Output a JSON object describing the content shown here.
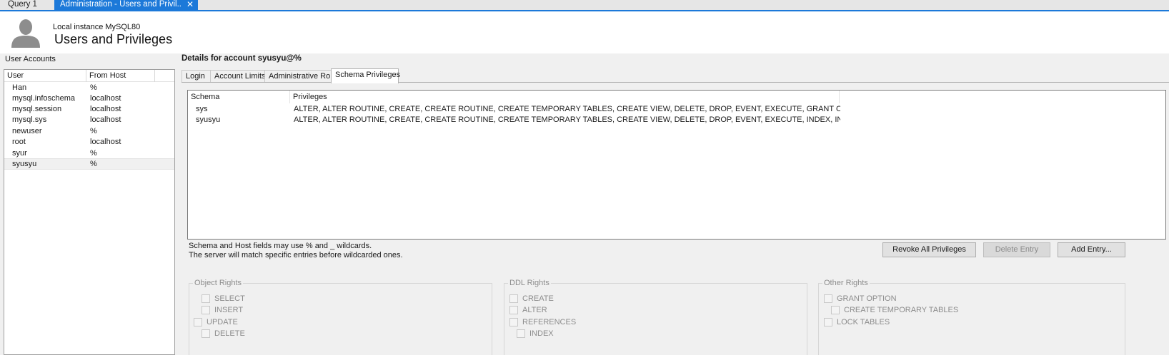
{
  "tabs": [
    {
      "label": "Query 1"
    },
    {
      "label": "Administration - Users and Privil..."
    }
  ],
  "header": {
    "subtitle": "Local instance MySQL80",
    "title": "Users and Privileges"
  },
  "accounts": {
    "label": "User Accounts",
    "columns": [
      "User",
      "From Host"
    ],
    "rows": [
      {
        "user": "Han",
        "host": "%"
      },
      {
        "user": "mysql.infoschema",
        "host": "localhost"
      },
      {
        "user": "mysql.session",
        "host": "localhost"
      },
      {
        "user": "mysql.sys",
        "host": "localhost"
      },
      {
        "user": "newuser",
        "host": "%"
      },
      {
        "user": "root",
        "host": "localhost"
      },
      {
        "user": "syur",
        "host": "%"
      },
      {
        "user": "syusyu",
        "host": "%"
      }
    ],
    "selected_user": "syusyu"
  },
  "details": {
    "label": "Details for account syusyu@%",
    "subtabs": [
      {
        "label": "Login"
      },
      {
        "label": "Account Limits"
      },
      {
        "label": "Administrative Roles"
      },
      {
        "label": "Schema Privileges"
      }
    ],
    "active_subtab": "Schema Privileges",
    "schema_table": {
      "columns": [
        "Schema",
        "Privileges"
      ],
      "rows": [
        {
          "schema": "sys",
          "privileges": "ALTER, ALTER ROUTINE, CREATE, CREATE ROUTINE, CREATE TEMPORARY TABLES, CREATE VIEW, DELETE, DROP, EVENT, EXECUTE, GRANT OPTION, IN..."
        },
        {
          "schema": "syusyu",
          "privileges": "ALTER, ALTER ROUTINE, CREATE, CREATE ROUTINE, CREATE TEMPORARY TABLES, CREATE VIEW, DELETE, DROP, EVENT, EXECUTE, INDEX, INSERT, LO..."
        }
      ]
    },
    "hint_line1": "Schema and Host fields may use % and _ wildcards.",
    "hint_line2": "The server will match specific entries before wildcarded ones.",
    "buttons": {
      "revoke": "Revoke All Privileges",
      "delete": "Delete Entry",
      "add": "Add Entry..."
    },
    "groups": {
      "object": {
        "title": "Object Rights",
        "items": [
          "SELECT",
          "INSERT",
          "UPDATE",
          "DELETE"
        ]
      },
      "ddl": {
        "title": "DDL Rights",
        "items": [
          "CREATE",
          "ALTER",
          "REFERENCES",
          "INDEX"
        ]
      },
      "other": {
        "title": "Other Rights",
        "items": [
          "GRANT OPTION",
          "CREATE TEMPORARY TABLES",
          "LOCK TABLES"
        ]
      }
    }
  }
}
